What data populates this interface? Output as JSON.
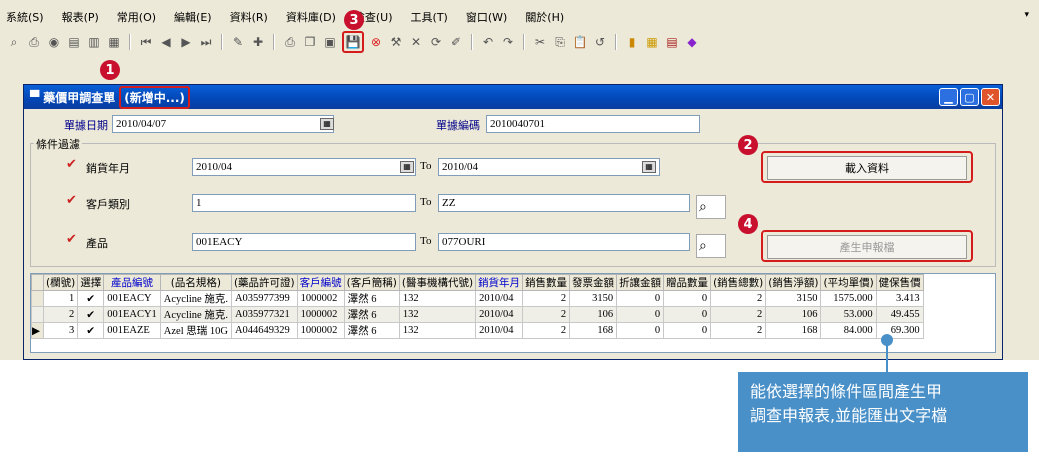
{
  "menu": [
    "系統(S)",
    "報表(P)",
    "常用(O)",
    "編輯(E)",
    "資料(R)",
    "資料庫(D)",
    "檢查(U)",
    "工具(T)",
    "窗口(W)",
    "關於(H)"
  ],
  "toolbar_icons": [
    "binoculars-icon",
    "print-icon",
    "preview-icon",
    "form-icon",
    "doc-icon",
    "table-icon",
    "first-icon",
    "prev-icon",
    "next-icon",
    "last-icon",
    "edit-icon",
    "new-icon",
    "print2-icon",
    "copy-icon",
    "paste-icon",
    "save-icon",
    "cancel-icon",
    "tools-icon",
    "delete-icon",
    "refresh-icon",
    "attach-icon",
    "undo-icon",
    "redo-icon",
    "cut-icon",
    "copy2-icon",
    "paste2-icon",
    "undo2-icon",
    "chart-icon",
    "calendar-icon",
    "book-icon",
    "gem-icon"
  ],
  "badges": {
    "one": "1",
    "two": "2",
    "three": "3",
    "four": "4"
  },
  "window": {
    "title": "藥價甲調查單",
    "status": "(新增中...)"
  },
  "header": {
    "doc_date_label": "單據日期",
    "doc_date": "2010/04/07",
    "doc_no_label": "單據編碼",
    "doc_no": "2010040701"
  },
  "filters": {
    "group_title": "條件過濾",
    "sales_month": {
      "label": "銷貨年月",
      "from": "2010/04",
      "to_label": "To",
      "to": "2010/04"
    },
    "customer_type": {
      "label": "客戶類別",
      "from": "1",
      "to_label": "To",
      "to": "ZZ"
    },
    "product": {
      "label": "產品",
      "from": "001EACY",
      "to_label": "To",
      "to": "077OURI"
    }
  },
  "buttons": {
    "load": "載入資料",
    "generate": "產生申報檔"
  },
  "table": {
    "columns": [
      "(欄號)",
      "選擇",
      "產品編號",
      "(品名規格)",
      "(藥品許可證)",
      "客戶編號",
      "(客戶簡稱)",
      "(醫事機構代號)",
      "銷貨年月",
      "銷售數量",
      "發票金額",
      "折讓金額",
      "贈品數量",
      "(銷售總數)",
      "(銷售淨額)",
      "(平均單價)",
      "健保售價"
    ],
    "rows": [
      [
        "1",
        "✔",
        "001EACY",
        "Acycline 施克.",
        "A035977399",
        "1000002",
        "澤然 6",
        "132",
        "2010/04",
        "2",
        "3150",
        "0",
        "0",
        "2",
        "3150",
        "1575.000",
        "3.413"
      ],
      [
        "2",
        "✔",
        "001EACY1",
        "Acycline 施克.",
        "A035977321",
        "1000002",
        "澤然 6",
        "132",
        "2010/04",
        "2",
        "106",
        "0",
        "0",
        "2",
        "106",
        "53.000",
        "49.455"
      ],
      [
        "3",
        "✔",
        "001EAZE",
        "Azel 思瑞 10G",
        "A044649329",
        "1000002",
        "澤然 6",
        "132",
        "2010/04",
        "2",
        "168",
        "0",
        "0",
        "2",
        "168",
        "84.000",
        "69.300"
      ]
    ]
  },
  "callout": {
    "line1": "能依選擇的條件區間產生甲",
    "line2": "調查申報表,並能匯出文字檔"
  }
}
